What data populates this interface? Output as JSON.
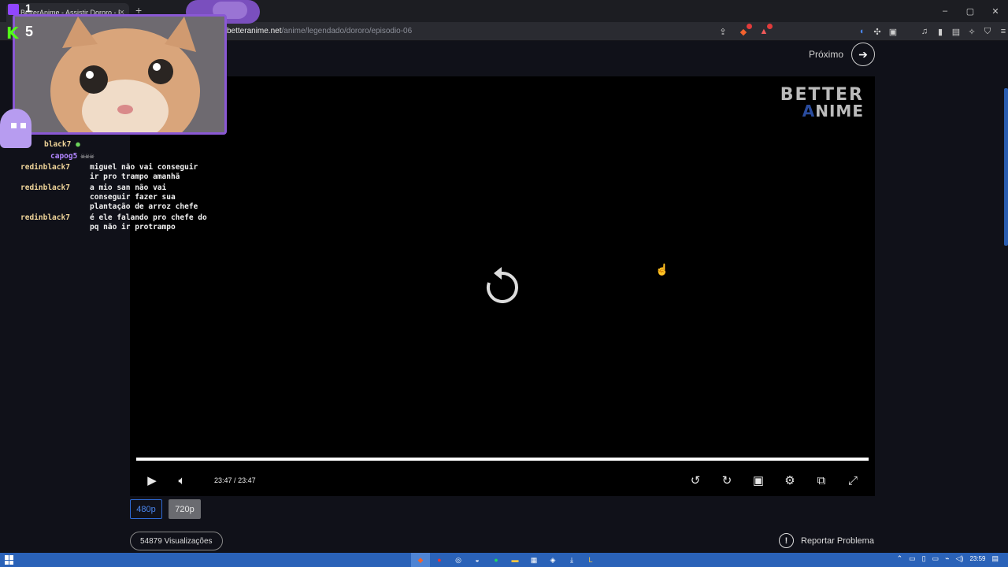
{
  "browser": {
    "tab_title": "BetterAnime - Assistir Dororo - E",
    "tab_close": "×",
    "new_tab": "+",
    "url_domain": "betteranime.net",
    "url_path": "/anime/legendado/dororo/episodio-06",
    "window_controls": [
      "–",
      "▢",
      "✕"
    ]
  },
  "page": {
    "next_label": "Próximo",
    "logo_top": "BETTER",
    "logo_bottom_accent": "A",
    "logo_bottom_rest": "NIME",
    "current_time": "23:47",
    "time_separator": "/",
    "duration": "23:47",
    "progress_percent": 100,
    "quality": [
      "480p",
      "720p"
    ],
    "views": "54879 Visualizações",
    "report": "Reportar Problema"
  },
  "overlay": {
    "twitch_count": "1",
    "kick_count": "5",
    "chat": [
      {
        "user": "redinblack7",
        "text": "miguel não vai conseguir ir pro trampo amanhã"
      },
      {
        "user": "redinblack7",
        "text": "a mio san não vai conseguir fazer sua plantação de arroz chefe"
      },
      {
        "user": "redinblack7",
        "text": "é ele falando pro chefe do pq não ir protrampo"
      }
    ],
    "partial_user": "black7",
    "sub_user": "capog5"
  },
  "taskbar": {
    "clock": "23:59"
  },
  "colors": {
    "accent_blue": "#2f6bd6",
    "overlay_purple": "#8a58d4",
    "kick_green": "#53fc18",
    "taskbar": "#2a62b8"
  }
}
